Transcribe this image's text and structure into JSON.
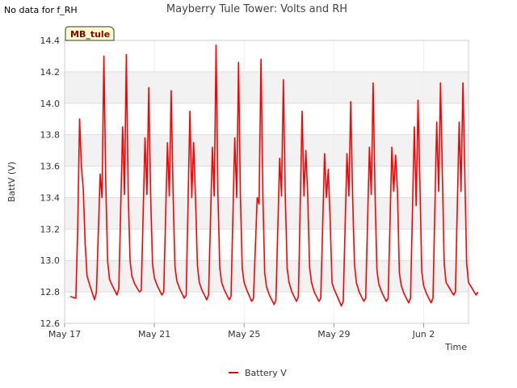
{
  "no_data_note": "No data for f_RH",
  "site_tag": "MB_tule",
  "chart_data": {
    "type": "line",
    "title": "Mayberry Tule Tower: Volts and RH",
    "xlabel": "Time",
    "ylabel": "BattV (V)",
    "ylim": [
      12.6,
      14.4
    ],
    "yticks": [
      12.6,
      12.8,
      13.0,
      13.2,
      13.4,
      13.6,
      13.8,
      14.0,
      14.2,
      14.4
    ],
    "ytick_labels": [
      "12.6",
      "12.8",
      "13.0",
      "13.2",
      "13.4",
      "13.6",
      "13.8",
      "14.0",
      "14.2",
      "14.4"
    ],
    "xlim": [
      "2024-05-17",
      "2024-06-04"
    ],
    "xticks": [
      "2024-05-17",
      "2024-05-21",
      "2024-05-25",
      "2024-05-29",
      "2024-06-02"
    ],
    "xtick_labels": [
      "May 17",
      "May 21",
      "May 25",
      "May 29",
      "Jun 2"
    ],
    "grid": true,
    "legend_position": "bottom-center",
    "series": [
      {
        "name": "Battery V",
        "color": "#ff0000",
        "x": [
          "2024-05-17T06:00",
          "2024-05-17T12:00",
          "2024-05-17T14:00",
          "2024-05-17T16:00",
          "2024-05-17T18:00",
          "2024-05-17T20:00",
          "2024-05-17T22:00",
          "2024-05-18T00:00",
          "2024-05-18T03:00",
          "2024-05-18T08:00",
          "2024-05-18T10:00",
          "2024-05-18T14:00",
          "2024-05-18T16:00",
          "2024-05-18T18:00",
          "2024-05-18T20:00",
          "2024-05-18T22:00",
          "2024-05-19T00:00",
          "2024-05-19T03:00",
          "2024-05-19T08:00",
          "2024-05-19T10:00",
          "2024-05-19T14:00",
          "2024-05-19T16:00",
          "2024-05-19T18:00",
          "2024-05-19T20:00",
          "2024-05-19T22:00",
          "2024-05-20T00:00",
          "2024-05-20T03:00",
          "2024-05-20T08:00",
          "2024-05-20T10:00",
          "2024-05-20T14:00",
          "2024-05-20T16:00",
          "2024-05-20T18:00",
          "2024-05-20T20:00",
          "2024-05-20T22:00",
          "2024-05-21T00:00",
          "2024-05-21T03:00",
          "2024-05-21T08:00",
          "2024-05-21T10:00",
          "2024-05-21T14:00",
          "2024-05-21T16:00",
          "2024-05-21T18:00",
          "2024-05-21T20:00",
          "2024-05-21T22:00",
          "2024-05-22T00:00",
          "2024-05-22T03:00",
          "2024-05-22T08:00",
          "2024-05-22T10:00",
          "2024-05-22T14:00",
          "2024-05-22T16:00",
          "2024-05-22T18:00",
          "2024-05-22T20:00",
          "2024-05-22T22:00",
          "2024-05-23T00:00",
          "2024-05-23T03:00",
          "2024-05-23T08:00",
          "2024-05-23T10:00",
          "2024-05-23T14:00",
          "2024-05-23T16:00",
          "2024-05-23T18:00",
          "2024-05-23T20:00",
          "2024-05-23T22:00",
          "2024-05-24T00:00",
          "2024-05-24T03:00",
          "2024-05-24T08:00",
          "2024-05-24T10:00",
          "2024-05-24T14:00",
          "2024-05-24T16:00",
          "2024-05-24T18:00",
          "2024-05-24T20:00",
          "2024-05-24T22:00",
          "2024-05-25T00:00",
          "2024-05-25T03:00",
          "2024-05-25T08:00",
          "2024-05-25T10:00",
          "2024-05-25T14:00",
          "2024-05-25T16:00",
          "2024-05-25T18:00",
          "2024-05-25T20:00",
          "2024-05-25T22:00",
          "2024-05-26T00:00",
          "2024-05-26T03:00",
          "2024-05-26T08:00",
          "2024-05-26T10:00",
          "2024-05-26T14:00",
          "2024-05-26T16:00",
          "2024-05-26T18:00",
          "2024-05-26T20:00",
          "2024-05-26T22:00",
          "2024-05-27T00:00",
          "2024-05-27T03:00",
          "2024-05-27T08:00",
          "2024-05-27T10:00",
          "2024-05-27T14:00",
          "2024-05-27T16:00",
          "2024-05-27T18:00",
          "2024-05-27T20:00",
          "2024-05-27T22:00",
          "2024-05-28T00:00",
          "2024-05-28T03:00",
          "2024-05-28T08:00",
          "2024-05-28T10:00",
          "2024-05-28T14:00",
          "2024-05-28T16:00",
          "2024-05-28T18:00",
          "2024-05-28T20:00",
          "2024-05-28T22:00",
          "2024-05-29T00:00",
          "2024-05-29T03:00",
          "2024-05-29T08:00",
          "2024-05-29T10:00",
          "2024-05-29T14:00",
          "2024-05-29T16:00",
          "2024-05-29T18:00",
          "2024-05-29T20:00",
          "2024-05-29T22:00",
          "2024-05-30T00:00",
          "2024-05-30T03:00",
          "2024-05-30T08:00",
          "2024-05-30T10:00",
          "2024-05-30T14:00",
          "2024-05-30T16:00",
          "2024-05-30T18:00",
          "2024-05-30T20:00",
          "2024-05-30T22:00",
          "2024-05-31T00:00",
          "2024-05-31T03:00",
          "2024-05-31T08:00",
          "2024-05-31T10:00",
          "2024-05-31T14:00",
          "2024-05-31T16:00",
          "2024-05-31T18:00",
          "2024-05-31T20:00",
          "2024-05-31T22:00",
          "2024-06-01T00:00",
          "2024-06-01T03:00",
          "2024-06-01T08:00",
          "2024-06-01T10:00",
          "2024-06-01T14:00",
          "2024-06-01T16:00",
          "2024-06-01T18:00",
          "2024-06-01T20:00",
          "2024-06-01T22:00",
          "2024-06-02T00:00",
          "2024-06-02T03:00",
          "2024-06-02T08:00",
          "2024-06-02T10:00",
          "2024-06-02T14:00",
          "2024-06-02T16:00",
          "2024-06-02T18:00",
          "2024-06-02T20:00",
          "2024-06-02T22:00",
          "2024-06-03T00:00",
          "2024-06-03T03:00",
          "2024-06-03T08:00",
          "2024-06-03T10:00",
          "2024-06-03T14:00",
          "2024-06-03T16:00",
          "2024-06-03T18:00",
          "2024-06-03T20:00",
          "2024-06-03T22:00",
          "2024-06-04T00:00",
          "2024-06-04T03:00",
          "2024-06-04T08:00",
          "2024-06-04T10:00"
        ],
        "y": [
          12.77,
          12.76,
          13.2,
          13.9,
          13.6,
          13.45,
          13.1,
          12.9,
          12.84,
          12.75,
          12.8,
          13.55,
          13.4,
          14.3,
          13.5,
          13.0,
          12.88,
          12.84,
          12.78,
          12.82,
          13.85,
          13.42,
          14.31,
          13.43,
          13.0,
          12.9,
          12.85,
          12.8,
          12.81,
          13.78,
          13.42,
          14.1,
          13.41,
          12.98,
          12.89,
          12.84,
          12.78,
          12.8,
          13.75,
          13.41,
          14.08,
          13.42,
          12.96,
          12.87,
          12.82,
          12.76,
          12.78,
          13.95,
          13.4,
          13.75,
          13.4,
          12.97,
          12.86,
          12.81,
          12.75,
          12.78,
          13.72,
          13.41,
          14.37,
          13.41,
          12.95,
          12.86,
          12.81,
          12.75,
          12.77,
          13.78,
          13.4,
          14.26,
          13.41,
          12.95,
          12.86,
          12.81,
          12.74,
          12.76,
          13.4,
          13.36,
          14.28,
          13.42,
          12.92,
          12.83,
          12.78,
          12.72,
          12.75,
          13.65,
          13.41,
          14.15,
          13.42,
          12.95,
          12.86,
          12.8,
          12.74,
          12.77,
          13.95,
          13.41,
          13.7,
          13.42,
          12.96,
          12.86,
          12.8,
          12.74,
          12.76,
          13.68,
          13.4,
          13.58,
          13.26,
          12.86,
          12.82,
          12.78,
          12.71,
          12.74,
          13.68,
          13.41,
          14.01,
          13.41,
          12.98,
          12.86,
          12.8,
          12.74,
          12.76,
          13.72,
          13.42,
          14.13,
          13.42,
          12.94,
          12.85,
          12.8,
          12.74,
          12.76,
          13.72,
          13.44,
          13.67,
          13.45,
          12.92,
          12.84,
          12.79,
          12.73,
          12.76,
          13.85,
          13.35,
          14.02,
          13.5,
          12.93,
          12.84,
          12.79,
          12.73,
          12.76,
          13.88,
          13.44,
          14.13,
          13.55,
          12.98,
          12.86,
          12.83,
          12.78,
          12.8,
          13.88,
          13.44,
          14.13,
          13.55,
          12.98,
          12.86,
          12.83,
          12.78,
          12.8
        ]
      }
    ]
  }
}
